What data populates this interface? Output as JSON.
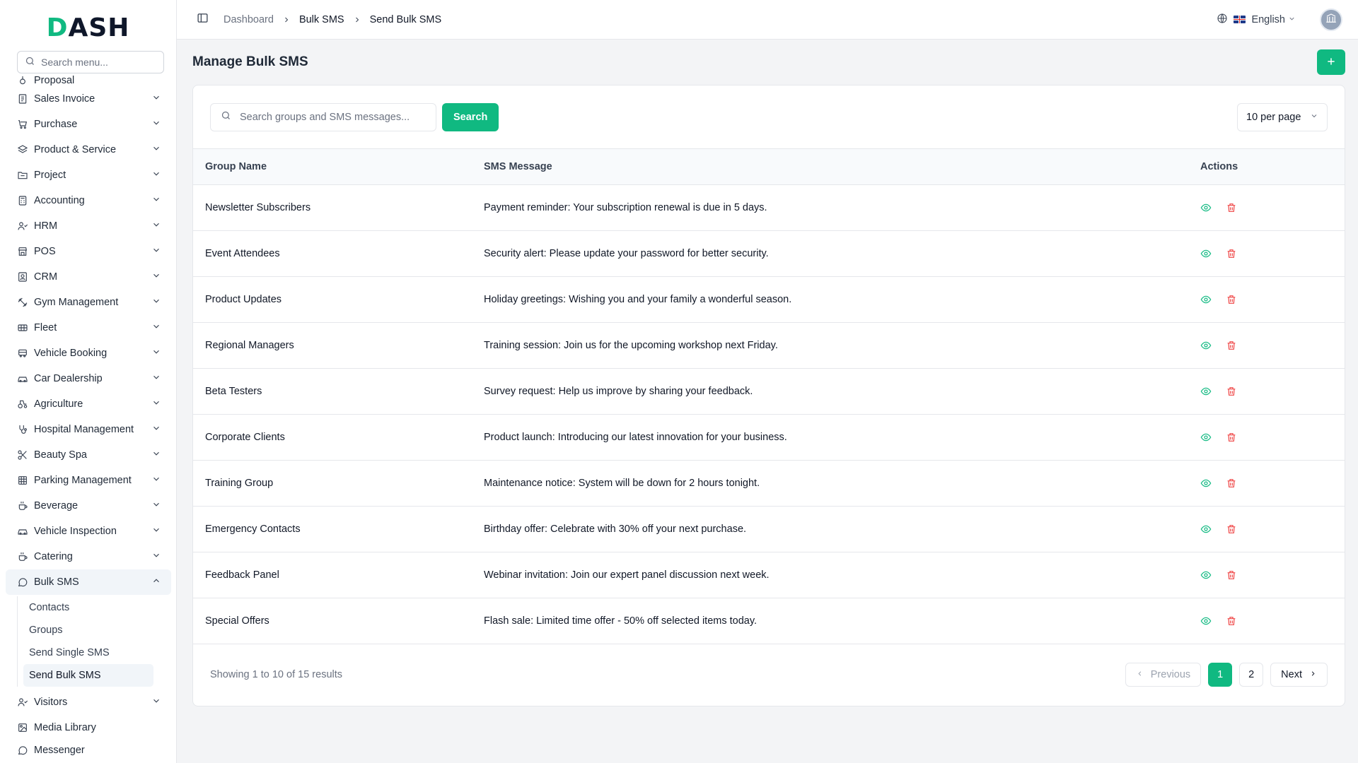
{
  "brand": {
    "logo_text": "DASH",
    "logo_mark": "D"
  },
  "sidebar": {
    "search_placeholder": "Search menu...",
    "items": [
      {
        "label": "Proposal",
        "icon": "proposal-icon",
        "partial": true
      },
      {
        "label": "Sales Invoice",
        "icon": "invoice-icon"
      },
      {
        "label": "Purchase",
        "icon": "cart-icon"
      },
      {
        "label": "Product & Service",
        "icon": "layers-icon"
      },
      {
        "label": "Project",
        "icon": "folder-icon"
      },
      {
        "label": "Accounting",
        "icon": "calculator-icon"
      },
      {
        "label": "HRM",
        "icon": "users-icon"
      },
      {
        "label": "POS",
        "icon": "store-icon"
      },
      {
        "label": "CRM",
        "icon": "contact-card-icon"
      },
      {
        "label": "Gym Management",
        "icon": "dumbbell-icon"
      },
      {
        "label": "Fleet",
        "icon": "truck-icon"
      },
      {
        "label": "Vehicle Booking",
        "icon": "bus-icon"
      },
      {
        "label": "Car Dealership",
        "icon": "car-icon"
      },
      {
        "label": "Agriculture",
        "icon": "tractor-icon"
      },
      {
        "label": "Hospital Management",
        "icon": "stethoscope-icon"
      },
      {
        "label": "Beauty Spa",
        "icon": "scissors-icon"
      },
      {
        "label": "Parking Management",
        "icon": "grid-icon"
      },
      {
        "label": "Beverage",
        "icon": "coffee-icon"
      },
      {
        "label": "Vehicle Inspection",
        "icon": "car-icon"
      },
      {
        "label": "Catering",
        "icon": "coffee-icon"
      },
      {
        "label": "Bulk SMS",
        "icon": "message-circle-icon",
        "expanded": true
      }
    ],
    "bulk_sms_sub": [
      "Contacts",
      "Groups",
      "Send Single SMS",
      "Send Bulk SMS"
    ],
    "bulk_sms_active_sub": "Send Bulk SMS",
    "after_items": [
      {
        "label": "Visitors",
        "icon": "user-check-icon",
        "chevron": true
      },
      {
        "label": "Media Library",
        "icon": "image-icon",
        "chevron": false
      },
      {
        "label": "Messenger",
        "icon": "message-circle-icon",
        "chevron": false,
        "partial": true
      }
    ]
  },
  "topbar": {
    "breadcrumb": [
      "Dashboard",
      "Bulk SMS",
      "Send Bulk SMS"
    ],
    "language": "English"
  },
  "page": {
    "title": "Manage Bulk SMS",
    "search_placeholder": "Search groups and SMS messages...",
    "search_button": "Search",
    "per_page": "10 per page"
  },
  "table": {
    "columns": [
      "Group Name",
      "SMS Message",
      "Actions"
    ],
    "rows": [
      {
        "group": "Newsletter Subscribers",
        "message": "Payment reminder: Your subscription renewal is due in 5 days."
      },
      {
        "group": "Event Attendees",
        "message": "Security alert: Please update your password for better security."
      },
      {
        "group": "Product Updates",
        "message": "Holiday greetings: Wishing you and your family a wonderful season."
      },
      {
        "group": "Regional Managers",
        "message": "Training session: Join us for the upcoming workshop next Friday."
      },
      {
        "group": "Beta Testers",
        "message": "Survey request: Help us improve by sharing your feedback."
      },
      {
        "group": "Corporate Clients",
        "message": "Product launch: Introducing our latest innovation for your business."
      },
      {
        "group": "Training Group",
        "message": "Maintenance notice: System will be down for 2 hours tonight."
      },
      {
        "group": "Emergency Contacts",
        "message": "Birthday offer: Celebrate with 30% off your next purchase."
      },
      {
        "group": "Feedback Panel",
        "message": "Webinar invitation: Join our expert panel discussion next week."
      },
      {
        "group": "Special Offers",
        "message": "Flash sale: Limited time offer - 50% off selected items today."
      }
    ]
  },
  "pagination": {
    "summary": "Showing 1 to 10 of 15 results",
    "previous": "Previous",
    "next": "Next",
    "pages": [
      "1",
      "2"
    ],
    "current": "1"
  },
  "colors": {
    "accent": "#10b981",
    "danger": "#ef4444"
  }
}
